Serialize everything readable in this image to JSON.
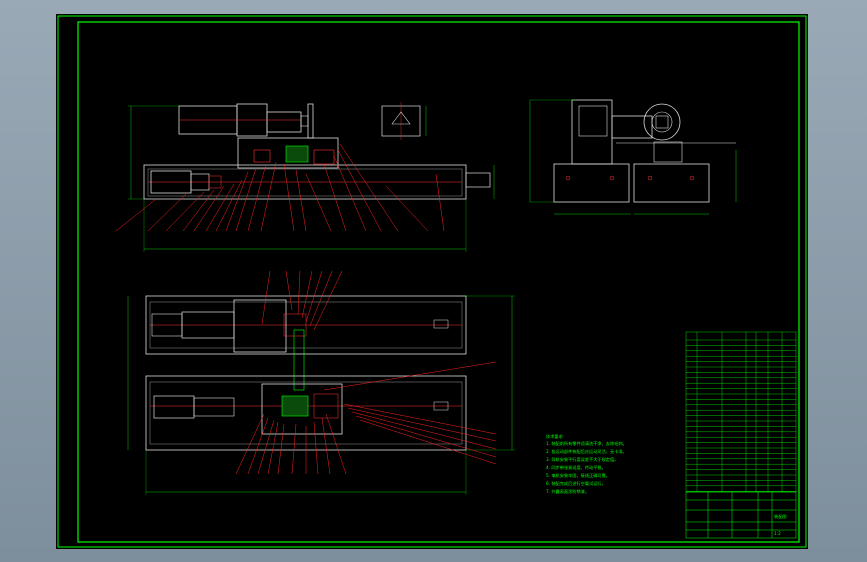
{
  "drawing": {
    "background": "#000000",
    "frame_color": "#00ff00",
    "leader_color": "#ff0000",
    "outline_color": "#ffffff"
  },
  "notes": {
    "heading": "技术要求",
    "lines": [
      "1. 装配前所有零件须清洗干净，去除毛刺。",
      "2. 各运动部件装配后应运动灵活，无卡滞。",
      "3. 导轨安装平行度误差不大于规定值。",
      "4. 同步带张紧适度，传动平稳。",
      "5. 电机安装牢固，接线正确可靠。",
      "6. 装配完成后进行空载试运行。",
      "7. 外露表面涂防锈漆。"
    ]
  },
  "title_block": {
    "drawing_name": "装配图",
    "scale": "1:2"
  }
}
